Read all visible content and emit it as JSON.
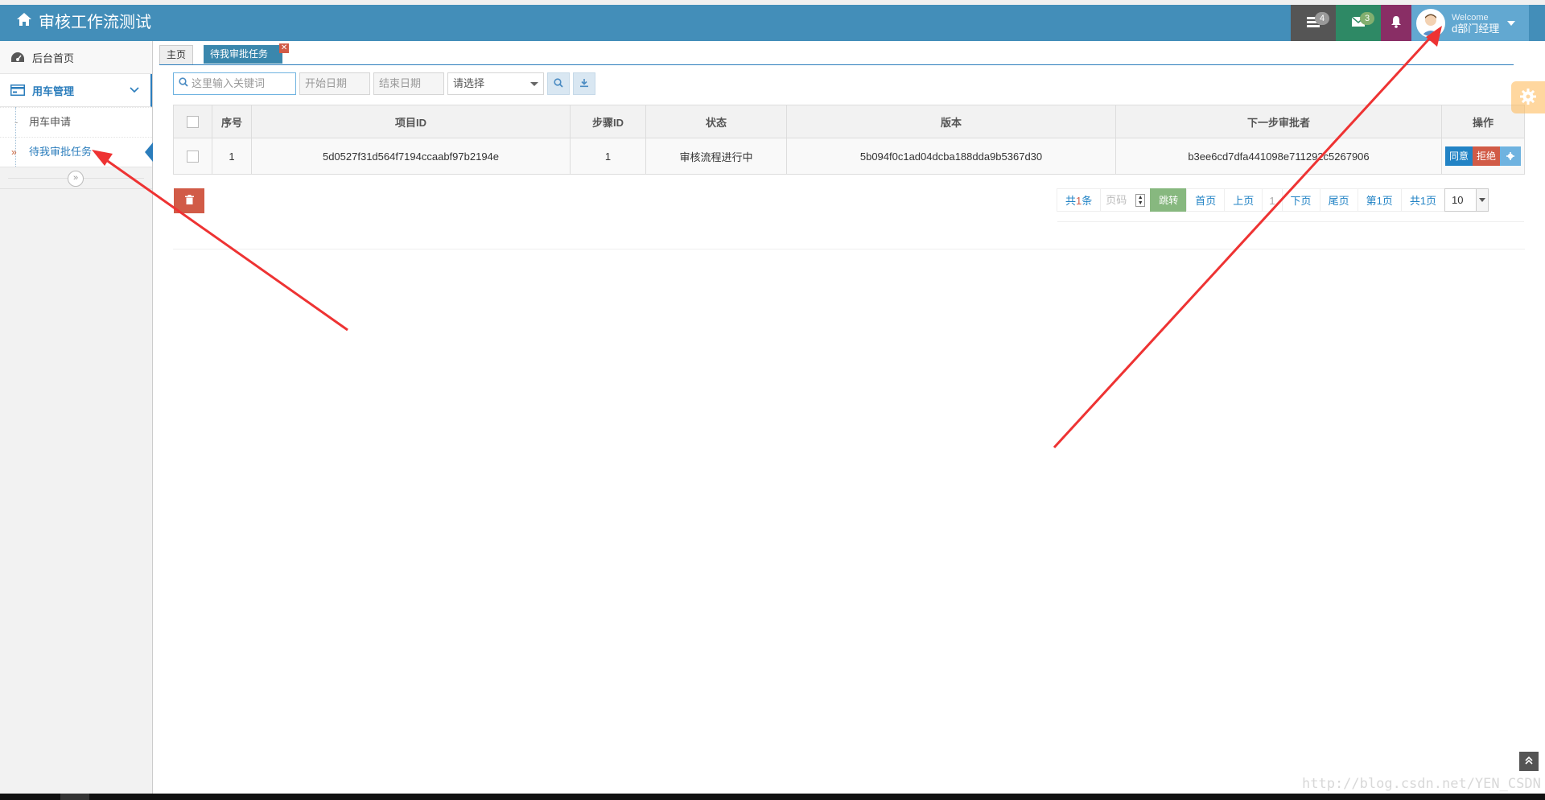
{
  "app": {
    "title": "审核工作流测试"
  },
  "navbar": {
    "tasks_count": "4",
    "mail_count": "3",
    "user": {
      "welcome": "Welcome",
      "name": "d部门经理"
    }
  },
  "sidebar": {
    "home": "后台首页",
    "group": "用车管理",
    "items": [
      {
        "label": "用车申请"
      },
      {
        "label": "待我审批任务"
      }
    ]
  },
  "tabs": {
    "home": "主页",
    "active": "待我审批任务"
  },
  "filters": {
    "search_placeholder": "这里输入关键词",
    "start_date_placeholder": "开始日期",
    "end_date_placeholder": "结束日期",
    "select_value": "请选择"
  },
  "table": {
    "headers": [
      "序号",
      "项目ID",
      "步骤ID",
      "状态",
      "版本",
      "下一步审批者",
      "操作"
    ],
    "rows": [
      {
        "index": "1",
        "project_id": "5d0527f31d564f7194ccaabf97b2194e",
        "step_id": "1",
        "status": "审核流程进行中",
        "version": "5b094f0c1ad04dcba188dda9b5367d30",
        "next_approver": "b3ee6cd7dfa441098e711292c5267906"
      }
    ],
    "actions": {
      "agree": "同意",
      "reject": "拒绝"
    }
  },
  "pager": {
    "total_prefix": "共",
    "total_count": "1",
    "total_suffix": "条",
    "page_placeholder": "页码",
    "go": "跳转",
    "first": "首页",
    "prev": "上页",
    "current": "1",
    "next": "下页",
    "last": "尾页",
    "page_info": "第1页",
    "page_total": "共1页",
    "page_size": "10"
  },
  "watermark": "http://blog.csdn.net/YEN_CSDN",
  "colors": {
    "navbar": "#438eb9",
    "accent": "#2b7dbc",
    "danger": "#d15b47",
    "success": "#87b87f",
    "annotation_arrow": "#ee3333"
  }
}
